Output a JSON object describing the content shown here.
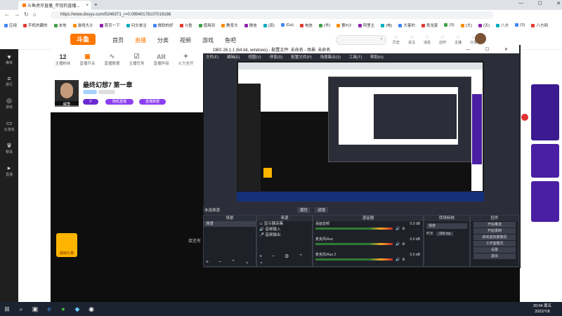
{
  "browser": {
    "tab_title": "斗鱼虎牙直播_年轻的直播...",
    "url": "https://www.douyu.com/5246371_r=0.09940178107019166",
    "bookmarks": [
      "应用",
      "手机的藏的",
      "本地",
      "游戏大计",
      "首页一下",
      "问文单注",
      "微软的好",
      "斗鱼",
      "使用到",
      "教育大",
      "微信",
      "(流)",
      "(Ga)",
      "电信",
      "(华)",
      "第P计",
      "阿里主",
      "(电)",
      "大客的",
      "青龙家",
      "(S)",
      "(大)",
      "(天)",
      "八方",
      "(S)",
      "八方网"
    ]
  },
  "douyu": {
    "logo": "斗鱼",
    "nav": [
      "首页",
      "直播",
      "分类",
      "视频",
      "游戏",
      "鱼吧"
    ],
    "top_icons": [
      "历史",
      "关注",
      "消息",
      "创作",
      "主播",
      "分享"
    ],
    "left_sidebar": [
      "推荐",
      "排行",
      "游戏",
      "云游戏",
      "赛事",
      "直播"
    ],
    "room": {
      "stats": [
        {
          "value": "12",
          "label": "主播粉丝"
        },
        {
          "value": "",
          "label": "直播开关"
        },
        {
          "value": "",
          "label": "直播数据"
        },
        {
          "value": "",
          "label": "主播任务"
        },
        {
          "value": "",
          "label": "直播伴侣"
        },
        {
          "value": "",
          "label": "火力全开"
        }
      ],
      "title": "最终幻想7 第一章",
      "host_name": "咸鱼",
      "tag1": "随机直播",
      "tag2": "直播数据",
      "gift_label": "超级礼物"
    }
  },
  "obs": {
    "title": "OBS 26.1.1 (64-bit, windows) - 配置文件: 未命名 - 场景: 未命名",
    "menu": [
      "文件(F)",
      "编辑(E)",
      "视图(V)",
      "停靠(D)",
      "配置文件(P)",
      "场景集合(S)",
      "工具(T)",
      "帮助(H)"
    ],
    "scene_bar": "未选择源",
    "scene_tabs": [
      "属性",
      "滤镜"
    ],
    "docks": {
      "scenes": {
        "title": "场景",
        "items": [
          "场景"
        ]
      },
      "sources": {
        "title": "来源",
        "items": [
          "显示器采集",
          "音频输入",
          "音频输出"
        ]
      },
      "mixer": {
        "title": "混音器",
        "tracks": [
          "桌面音频",
          "麦克风/Aux",
          "麦克风/Aux 2"
        ],
        "db": "0.0 dB"
      },
      "transitions": {
        "title": "转场特效",
        "mode": "渐变",
        "duration_label": "时长",
        "duration": "300 ms"
      },
      "controls": {
        "title": "控件",
        "buttons": [
          "开始推流",
          "开始录制",
          "启动虚拟摄像机",
          "工作室模式",
          "设置",
          "退出"
        ]
      }
    }
  },
  "stream_overlay": "接还有",
  "taskbar": {
    "time": "20:04 周五",
    "date": "2022/7/8"
  },
  "colors": {
    "accent": "#ff7700",
    "obs_bg": "#2b2e38",
    "stream_bg": "#0e0e0e",
    "purple": "#6a2bd1"
  }
}
